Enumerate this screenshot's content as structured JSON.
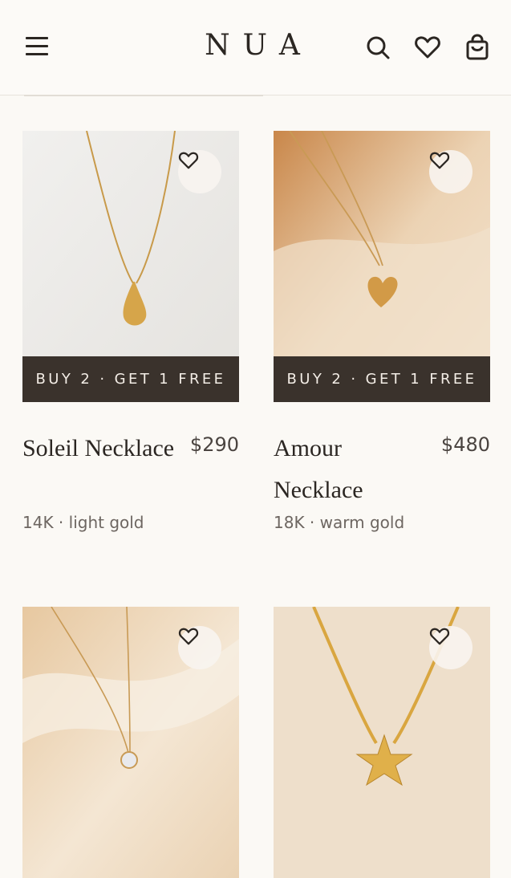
{
  "brand": {
    "logo": "NUA"
  },
  "header": {
    "icons": [
      "menu-icon",
      "search-icon",
      "heart-icon",
      "bag-icon"
    ]
  },
  "products": [
    {
      "name": "Soleil Necklace",
      "price": "$290",
      "meta": "14K · light gold",
      "promo": "BUY 2 · GET 1 FREE"
    },
    {
      "name": "Amour Necklace",
      "price": "$480",
      "meta": "18K · warm gold",
      "promo": "BUY 2 · GET 1 FREE"
    },
    {
      "name": "",
      "price": "",
      "meta": "",
      "promo": ""
    },
    {
      "name": "",
      "price": "",
      "meta": "",
      "promo": ""
    }
  ],
  "colors": {
    "background": "#fbf9f5",
    "promo_banner": "#3a322c",
    "text": "#2b2622"
  }
}
